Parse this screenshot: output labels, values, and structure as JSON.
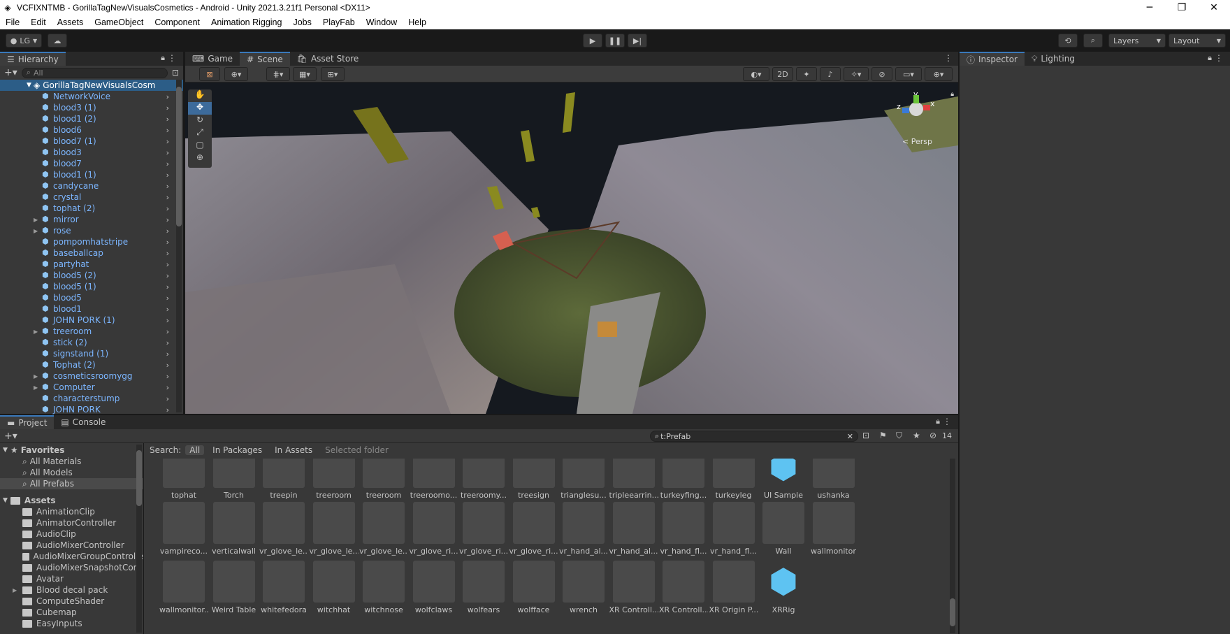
{
  "window": {
    "title": "VCFIXNTMB - GorillaTagNewVisualsCosmetics - Android - Unity 2021.3.21f1 Personal <DX11>",
    "controls": {
      "minimize": "─",
      "maximize": "❐",
      "close": "✕"
    }
  },
  "menu": [
    "File",
    "Edit",
    "Assets",
    "GameObject",
    "Component",
    "Animation Rigging",
    "Jobs",
    "PlayFab",
    "Window",
    "Help"
  ],
  "toolbar": {
    "account": "LG",
    "layers_label": "Layers",
    "layout_label": "Layout"
  },
  "hierarchy": {
    "tab": "Hierarchy",
    "search_placeholder": "All",
    "scene_name": "GorillaTagNewVisualsCosm",
    "items": [
      {
        "label": "NetworkVoice",
        "expandable": false
      },
      {
        "label": "blood3 (1)",
        "expandable": false
      },
      {
        "label": "blood1 (2)",
        "expandable": false
      },
      {
        "label": "blood6",
        "expandable": false
      },
      {
        "label": "blood7 (1)",
        "expandable": false
      },
      {
        "label": "blood3",
        "expandable": false
      },
      {
        "label": "blood7",
        "expandable": false
      },
      {
        "label": "blood1 (1)",
        "expandable": false
      },
      {
        "label": "candycane",
        "expandable": false
      },
      {
        "label": "crystal",
        "expandable": false
      },
      {
        "label": "tophat (2)",
        "expandable": false
      },
      {
        "label": "mirror",
        "expandable": true
      },
      {
        "label": "rose",
        "expandable": true
      },
      {
        "label": "pompomhatstripe",
        "expandable": false
      },
      {
        "label": "baseballcap",
        "expandable": false
      },
      {
        "label": "partyhat",
        "expandable": false
      },
      {
        "label": "blood5 (2)",
        "expandable": false
      },
      {
        "label": "blood5 (1)",
        "expandable": false
      },
      {
        "label": "blood5",
        "expandable": false
      },
      {
        "label": "blood1",
        "expandable": false
      },
      {
        "label": "JOHN PORK (1)",
        "expandable": false
      },
      {
        "label": "treeroom",
        "expandable": true
      },
      {
        "label": "stick (2)",
        "expandable": false
      },
      {
        "label": "signstand (1)",
        "expandable": false
      },
      {
        "label": "Tophat (2)",
        "expandable": false
      },
      {
        "label": "cosmeticsroomygg",
        "expandable": true
      },
      {
        "label": "Computer",
        "expandable": true
      },
      {
        "label": "characterstump",
        "expandable": false
      },
      {
        "label": "JOHN PORK",
        "expandable": false
      }
    ]
  },
  "center_tabs": [
    "Game",
    "Scene",
    "Asset Store"
  ],
  "scene": {
    "toggle_2d": "2D",
    "persp_label": "< Persp",
    "gizmo_axes": [
      "y",
      "x",
      "z"
    ]
  },
  "right_tabs": [
    "Inspector",
    "Lighting"
  ],
  "project": {
    "tabs": [
      "Project",
      "Console"
    ],
    "search_value": "t:Prefab",
    "hidden_count": "14",
    "search_label": "Search:",
    "filters": [
      "All",
      "In Packages",
      "In Assets",
      "Selected folder"
    ],
    "favorites_label": "Favorites",
    "favorites": [
      "All Materials",
      "All Models",
      "All Prefabs"
    ],
    "assets_label": "Assets",
    "folders": [
      {
        "label": "AnimationClip",
        "expandable": false
      },
      {
        "label": "AnimatorController",
        "expandable": false
      },
      {
        "label": "AudioClip",
        "expandable": false
      },
      {
        "label": "AudioMixerController",
        "expandable": false
      },
      {
        "label": "AudioMixerGroupControlle",
        "expandable": false
      },
      {
        "label": "AudioMixerSnapshotCont",
        "expandable": false
      },
      {
        "label": "Avatar",
        "expandable": false
      },
      {
        "label": "Blood decal pack",
        "expandable": true
      },
      {
        "label": "ComputeShader",
        "expandable": false
      },
      {
        "label": "Cubemap",
        "expandable": false
      },
      {
        "label": "EasyInputs",
        "expandable": false
      }
    ],
    "grid_rows": [
      [
        "tophat",
        "Torch",
        "treepin",
        "treeroom",
        "treeroom",
        "treeroomo...",
        "treeroomy...",
        "treesign",
        "trianglesu...",
        "tripleearrin...",
        "turkeyfing...",
        "turkeyleg",
        "UI Sample",
        "ushanka"
      ],
      [
        "vampireco...",
        "verticalwall",
        "vr_glove_le...",
        "vr_glove_le...",
        "vr_glove_le...",
        "vr_glove_ri...",
        "vr_glove_ri...",
        "vr_glove_ri...",
        "vr_hand_al...",
        "vr_hand_al...",
        "vr_hand_fl...",
        "vr_hand_fl...",
        "Wall",
        "wallmonitor"
      ],
      [
        "wallmonitor...",
        "Weird Table",
        "whitefedora",
        "witchhat",
        "witchnose",
        "wolfclaws",
        "wolfears",
        "wolfface",
        "wrench",
        "XR Controll...",
        "XR Controll...",
        "XR Origin P...",
        "XRRig"
      ]
    ]
  }
}
